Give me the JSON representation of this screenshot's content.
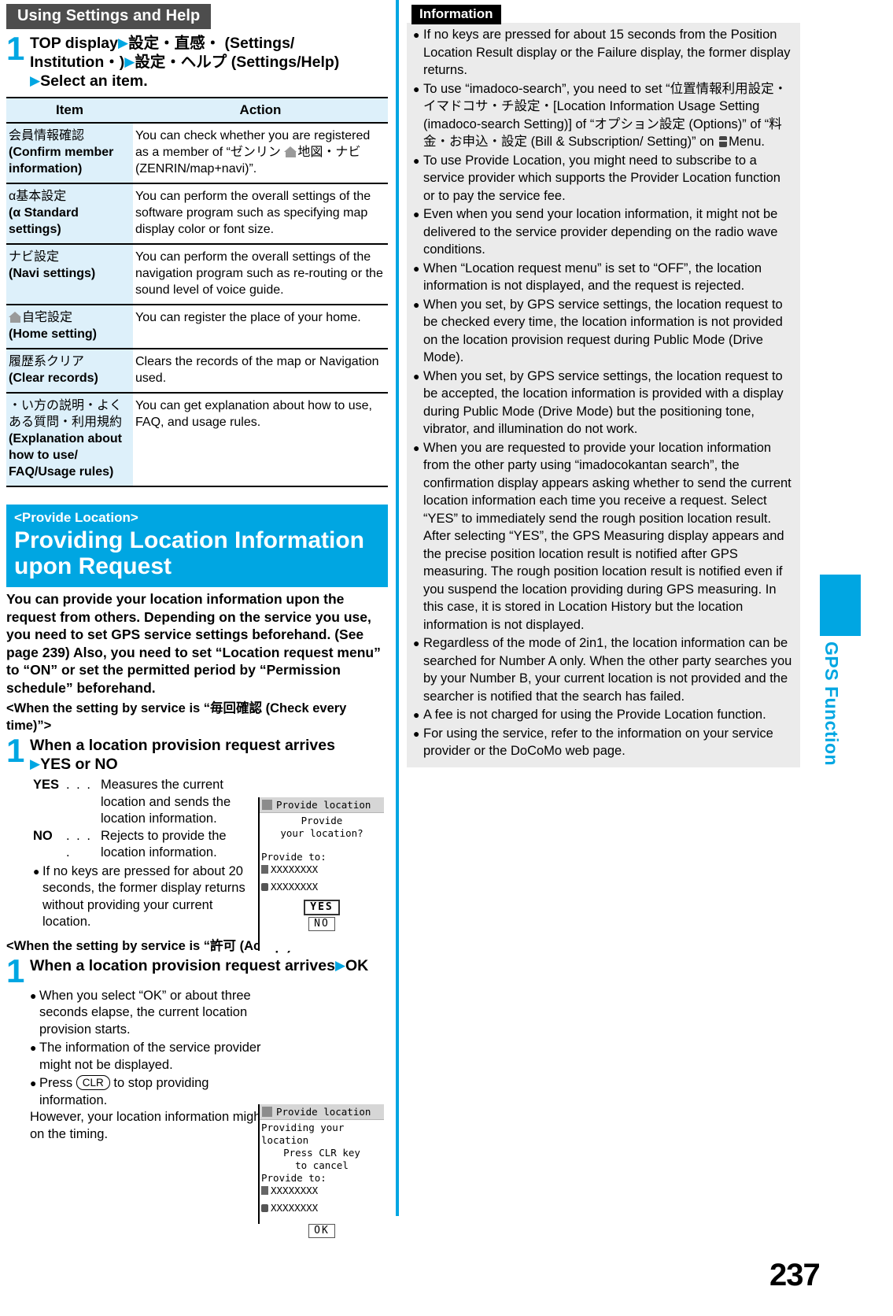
{
  "page_number": "237",
  "side_tab": {
    "label": "GPS Function",
    "color": "#00a6e2"
  },
  "left": {
    "section_title": "Using Settings and Help",
    "step1": {
      "number": "1",
      "line1_a": "TOP display",
      "line1_b": "設定・直感・ (Settings/",
      "line2_a": "Institution・)",
      "line2_b": "設定・ヘルプ (Settings/Help)",
      "line3": "Select an item."
    },
    "table": {
      "headers": [
        "Item",
        "Action"
      ],
      "rows": [
        {
          "item_jp": "会員情報確認",
          "item_en": "(Confirm member information)",
          "action": "You can check whether you are registered as a member of “ゼンリン 地図・ナビ (ZENRIN/map+navi)”.",
          "action_has_home_icon": true
        },
        {
          "item_jp": "α基本設定",
          "item_en": "(α Standard settings)",
          "action": "You can perform the overall settings of the software program such as specifying map display color or font size."
        },
        {
          "item_jp": "ナビ設定",
          "item_en": "(Navi settings)",
          "action": "You can perform the overall settings of the navigation program such as re-routing or the sound level of voice guide."
        },
        {
          "item_jp": "自宅設定",
          "item_en": "(Home setting)",
          "item_has_home_icon": true,
          "action": "You can register the place of your home."
        },
        {
          "item_jp": "履歴系クリア",
          "item_en": "(Clear records)",
          "action": "Clears the records of the map or Navigation used."
        },
        {
          "item_jp": "・い方の説明・よくある質問・利用規約",
          "item_en": "(Explanation about how to use/ FAQ/Usage rules)",
          "action": "You can get explanation about how to use, FAQ, and usage rules."
        }
      ]
    },
    "title_block": {
      "kicker": "<Provide Location>",
      "title": "Providing Location Information upon Request",
      "bg": "#00a6e2"
    },
    "lead": "You can provide your location information upon the request from others. Depending on the service you use, you need to set GPS service settings beforehand. (See page 239) Also, you need to set “Location request menu” to “ON” or set the permitted period by “Permission schedule” beforehand.",
    "condition1": "<When the setting by service is “毎回確認 (Check every time)”>",
    "step_a": {
      "number": "1",
      "line1": "When a location provision request arrives",
      "line2": "YES or NO",
      "defs": [
        {
          "key": "YES",
          "dots": ". . .",
          "value": "Measures the current location and sends the location information."
        },
        {
          "key": "NO",
          "dots": ". . . .",
          "value": "Rejects to provide the location information."
        }
      ],
      "bullet": "If no keys are pressed for about 20 seconds, the former display returns without providing your current location."
    },
    "condition2": "<When the setting by service is “許可 (Accept)”>",
    "step_b": {
      "number": "1",
      "line1": "When a location provision request arrives",
      "line1_tail": "OK",
      "bullets": [
        "When you select “OK” or about three seconds elapse, the current location provision starts.",
        "The information of the service provider might not be displayed.",
        "Press CLR to stop providing information."
      ],
      "bullet3_prefix": "Press",
      "bullet3_key": "CLR",
      "bullet3_suffix": "to stop providing information.",
      "trailing": "However, your location information might be sent depending on the timing."
    },
    "mock1": {
      "title": "Provide location",
      "center_line1": "Provide",
      "center_line2": "your location?",
      "label": "Provide to:",
      "value1": "XXXXXXXX",
      "value2": "XXXXXXXX",
      "btn_yes": "YES",
      "btn_no": "NO"
    },
    "mock2": {
      "title": "Provide location",
      "line1": "Providing your location",
      "line2": "Press CLR key",
      "line3": "to cancel",
      "label": "Provide to:",
      "value1": "XXXXXXXX",
      "value2": "XXXXXXXX",
      "btn_ok": "OK"
    }
  },
  "right": {
    "info_heading": "Information",
    "items": [
      "If no keys are pressed for about 15 seconds from the Position Location Result display or the Failure display, the former display returns.",
      "To use “imadoco-search”, you need to set “位置情報利用設定・イマドコサ・チ設定・[Location Information Usage Setting (imadoco-search Setting)] of “オプション設定 (Options)” of “料金・お申込・設定 (Bill & Subscription/ Setting)” on  Menu.",
      "To use Provide Location, you might need to subscribe to a service provider which supports the Provider Location function or to pay the service fee.",
      "Even when you send your location information, it might not be delivered to the service provider depending on the radio wave conditions.",
      "When “Location request menu” is set to “OFF”, the location information is not displayed, and the request is rejected.",
      "When you set, by GPS service settings, the location request to be checked every time, the location information is not provided on the location provision request during Public Mode (Drive Mode).",
      "When you set, by GPS service settings, the location request to be accepted, the location information is provided with a display during Public Mode (Drive Mode) but the positioning tone, vibrator, and illumination do not work.",
      "When you are requested to provide your location information from the other party using “imadocokantan search”, the confirmation display appears asking whether to send the current location information each time you receive a request. Select “YES” to immediately send the rough position location result. After selecting “YES”, the GPS Measuring display appears and the precise position location result is notified after GPS measuring. The rough position location result is notified even if you suspend the location providing during GPS measuring. In this case, it is stored in Location History but the location information is not displayed.",
      "Regardless of the mode of 2in1, the location information can be searched for Number A only. When the other party searches you by your Number B, your current location is not provided and the searcher is notified that the search has failed.",
      "A fee is not charged for using the Provide Location function.",
      "For using the service, refer to the information on your service provider or the DoCoMo web page."
    ],
    "item2_has_menu_icon": true
  }
}
